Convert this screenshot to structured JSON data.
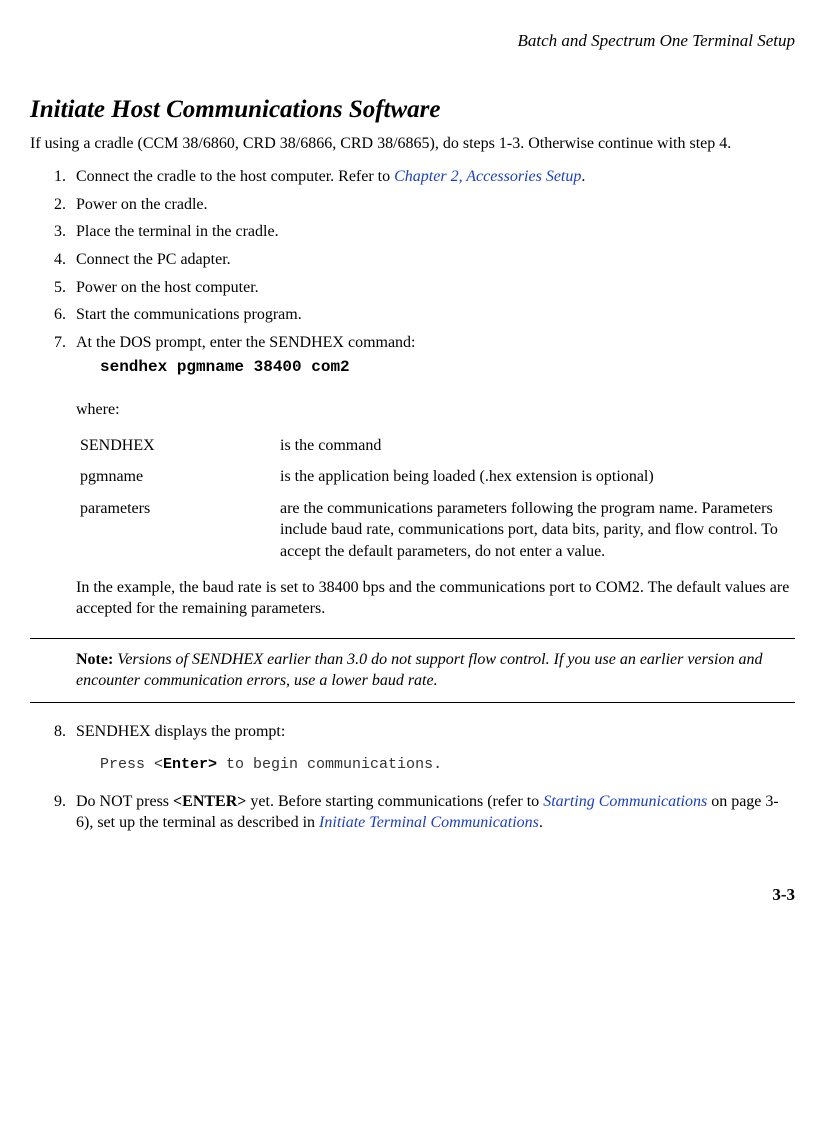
{
  "running_header": "Batch and Spectrum One Terminal Setup",
  "section_title": "Initiate Host Communications Software",
  "intro": "If using a cradle (CCM 38/6860, CRD 38/6866, CRD 38/6865), do steps 1-3. Otherwise continue with step 4.",
  "steps": {
    "s1_a": "Connect the cradle to the host computer. Refer to ",
    "s1_link": "Chapter 2, Accessories Setup",
    "s1_b": ".",
    "s2": "Power on the cradle.",
    "s3": "Place the terminal in the cradle.",
    "s4": "Connect the PC adapter.",
    "s5": "Power on the host computer.",
    "s6": "Start the communications program.",
    "s7": "At the DOS prompt, enter the SENDHEX command:",
    "s7_cmd": "sendhex pgmname 38400 com2",
    "s7_where": "where:",
    "s7_def": [
      {
        "term": "SENDHEX",
        "desc": "is the command"
      },
      {
        "term": "pgmname",
        "desc": "is the application being loaded (.hex extension is optional)"
      },
      {
        "term": "parameters",
        "desc": "are the communications parameters following the program name. Parameters include baud rate, communications port, data bits, parity, and flow control. To accept the default parameters, do not enter a value."
      }
    ],
    "s7_example": "In the example, the baud rate is set to 38400 bps and the communications port to COM2. The default values are accepted for the remaining parameters.",
    "note_label": "Note:",
    "note_body": " Versions of SENDHEX earlier than 3.0 do not support flow control. If you use an earlier version and encounter communication errors, use a lower baud rate.",
    "s8": "SENDHEX displays the prompt:",
    "s8_prompt_a": "Press <",
    "s8_prompt_bold": "Enter>",
    "s8_prompt_b": " to begin communications.",
    "s9_a": "Do NOT press ",
    "s9_bold": "<ENTER>",
    "s9_b": " yet. Before starting communications (refer to ",
    "s9_link1": "Starting Communications",
    "s9_c": " on page 3-6), set up the terminal as described in ",
    "s9_link2": "Initiate Terminal Communications",
    "s9_d": "."
  },
  "page_num": "3-3"
}
